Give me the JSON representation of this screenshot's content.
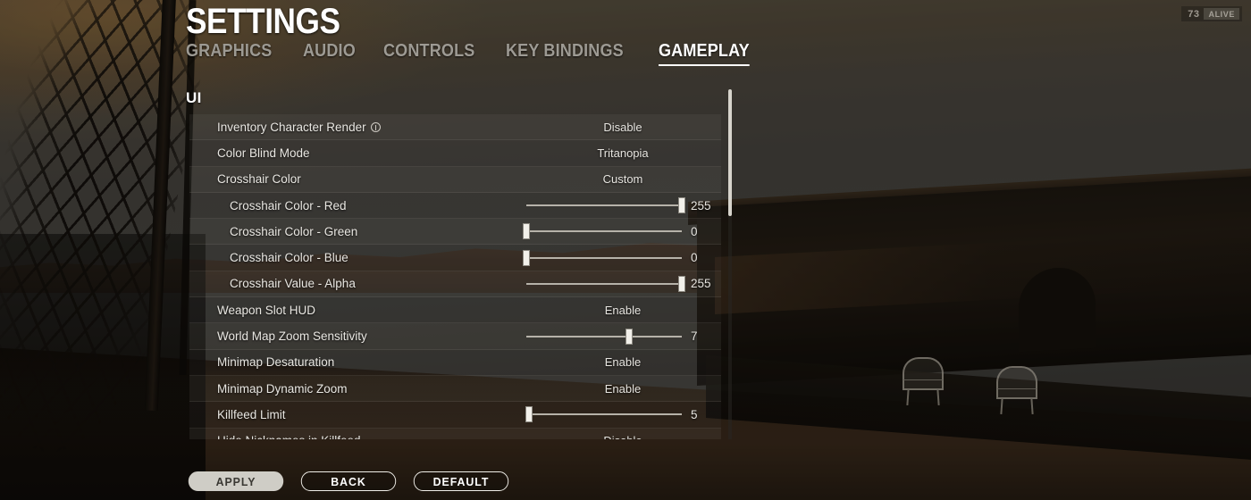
{
  "hud": {
    "alive_count": "73",
    "alive_label": "ALIVE"
  },
  "header": {
    "title": "SETTINGS"
  },
  "tabs": [
    {
      "label": "GRAPHICS",
      "active": false
    },
    {
      "label": "AUDIO",
      "active": false
    },
    {
      "label": "CONTROLS",
      "active": false
    },
    {
      "label": "KEY BINDINGS",
      "active": false
    },
    {
      "label": "GAMEPLAY",
      "active": true
    }
  ],
  "section": {
    "title": "UI"
  },
  "settings_rows": [
    {
      "name": "inventory-character-render",
      "label": "Inventory Character Render",
      "info_icon": true,
      "indent": false,
      "type": "enum",
      "value": "Disable"
    },
    {
      "name": "color-blind-mode",
      "label": "Color Blind Mode",
      "info_icon": false,
      "indent": false,
      "type": "enum",
      "value": "Tritanopia"
    },
    {
      "name": "crosshair-color",
      "label": "Crosshair Color",
      "info_icon": false,
      "indent": false,
      "type": "enum",
      "value": "Custom"
    },
    {
      "name": "crosshair-color-red",
      "label": "Crosshair Color - Red",
      "info_icon": false,
      "indent": true,
      "type": "slider",
      "value": "255",
      "percent": 100
    },
    {
      "name": "crosshair-color-green",
      "label": "Crosshair Color - Green",
      "info_icon": false,
      "indent": true,
      "type": "slider",
      "value": "0",
      "percent": 0
    },
    {
      "name": "crosshair-color-blue",
      "label": "Crosshair Color - Blue",
      "info_icon": false,
      "indent": true,
      "type": "slider",
      "value": "0",
      "percent": 0
    },
    {
      "name": "crosshair-value-alpha",
      "label": "Crosshair Value - Alpha",
      "info_icon": false,
      "indent": true,
      "type": "slider",
      "value": "255",
      "percent": 100
    },
    {
      "name": "weapon-slot-hud",
      "label": "Weapon Slot HUD",
      "info_icon": false,
      "indent": false,
      "type": "enum",
      "value": "Enable"
    },
    {
      "name": "world-map-zoom-sensitivity",
      "label": "World Map Zoom Sensitivity",
      "info_icon": false,
      "indent": false,
      "type": "slider",
      "value": "7",
      "percent": 66
    },
    {
      "name": "minimap-desaturation",
      "label": "Minimap Desaturation",
      "info_icon": false,
      "indent": false,
      "type": "enum",
      "value": "Enable"
    },
    {
      "name": "minimap-dynamic-zoom",
      "label": "Minimap Dynamic Zoom",
      "info_icon": false,
      "indent": false,
      "type": "enum",
      "value": "Enable"
    },
    {
      "name": "killfeed-limit",
      "label": "Killfeed Limit",
      "info_icon": false,
      "indent": false,
      "type": "slider",
      "value": "5",
      "percent": 2
    },
    {
      "name": "hide-nicknames-in-killfeed",
      "label": "Hide Nicknames in Killfeed",
      "info_icon": false,
      "indent": false,
      "type": "enum",
      "value": "Disable"
    }
  ],
  "footer_buttons": [
    {
      "name": "apply-button",
      "label": "APPLY",
      "style": "primary"
    },
    {
      "name": "back-button",
      "label": "BACK",
      "style": "outline"
    },
    {
      "name": "default-button",
      "label": "DEFAULT",
      "style": "outline"
    }
  ],
  "colors": {
    "accent_white": "#ffffff",
    "inactive_tab": "#9d9a93",
    "row_text": "#e9e7e2",
    "slider_track": "#b6b2a9",
    "slider_thumb": "#f2f0ea",
    "apply_fill": "#cfcdc6"
  }
}
